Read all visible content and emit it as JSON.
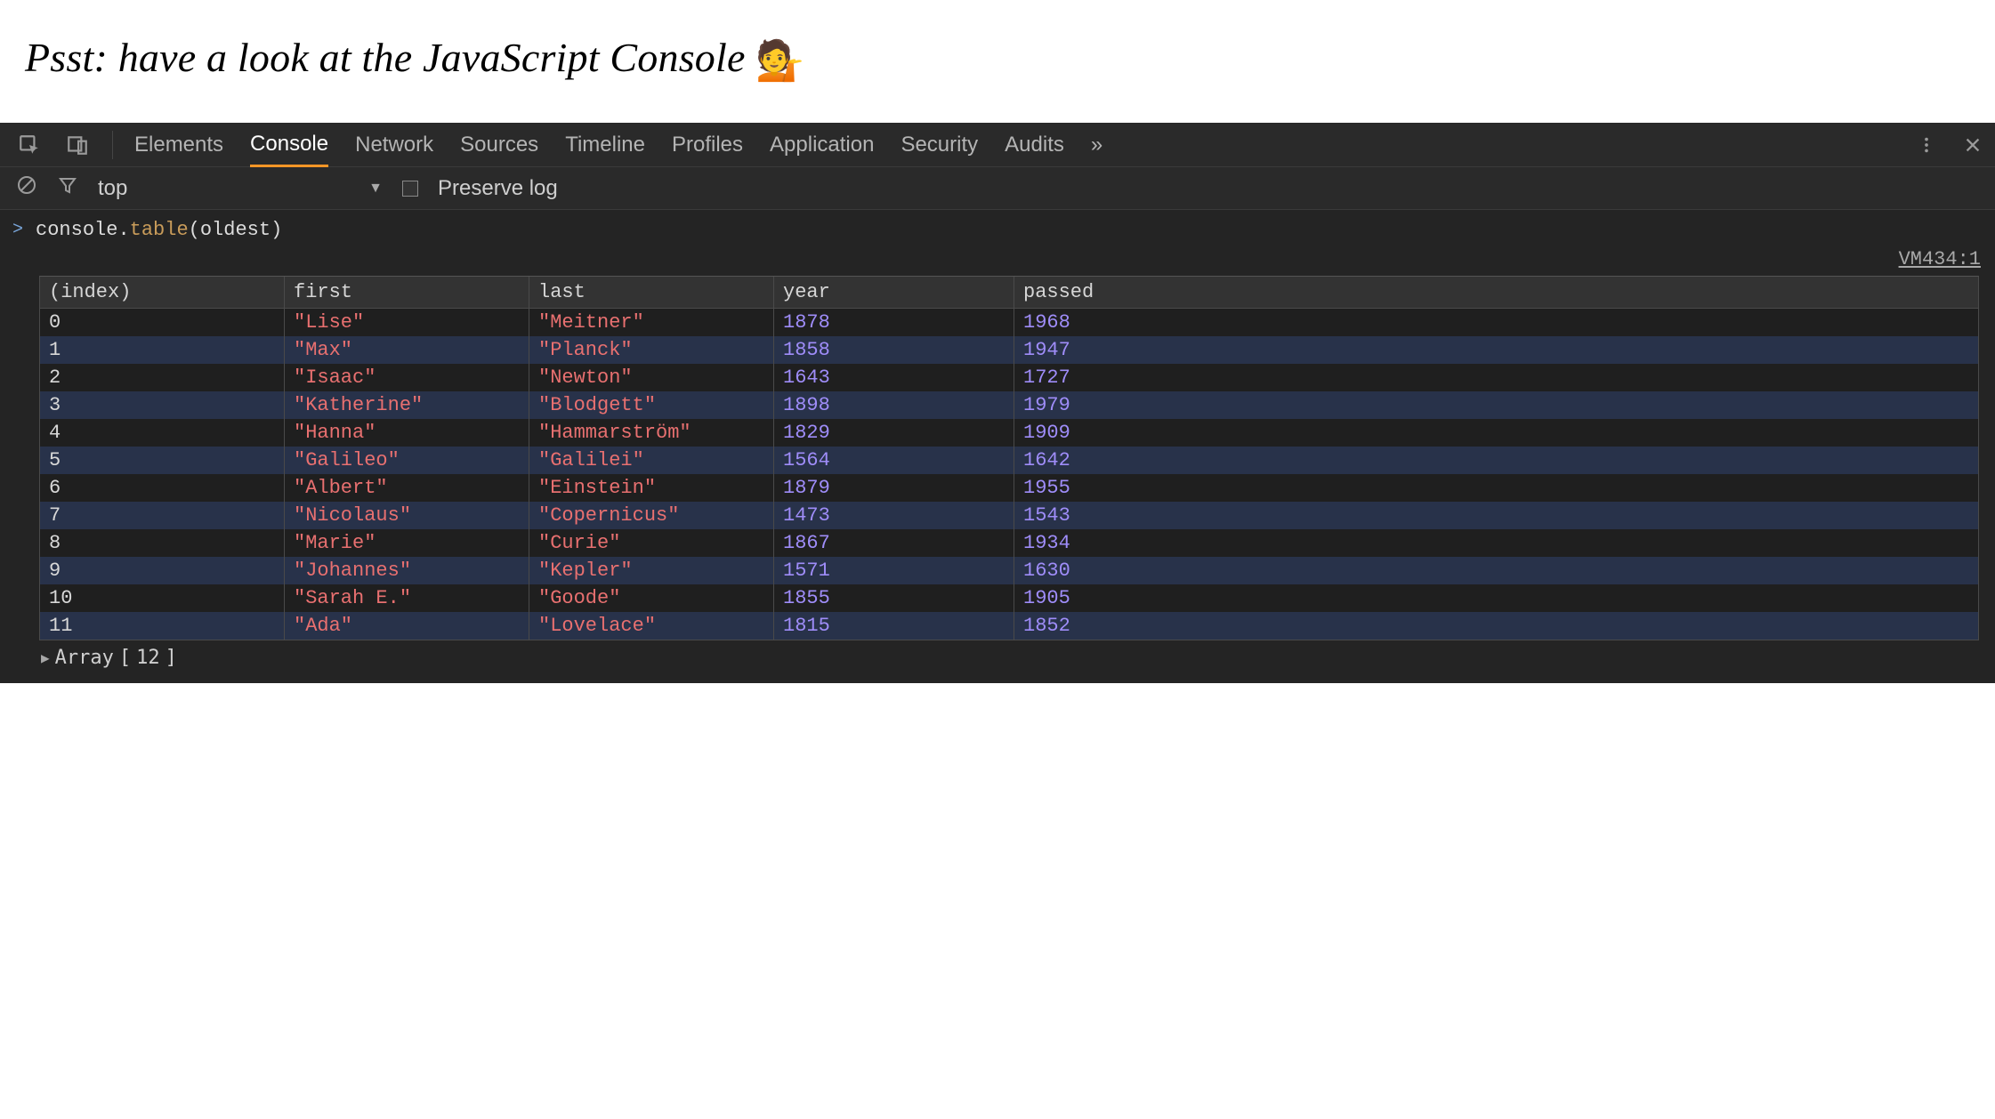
{
  "page": {
    "hint_text": "Psst: have a look at the JavaScript Console",
    "hint_emoji": "💁"
  },
  "devtools": {
    "tabs": [
      "Elements",
      "Console",
      "Network",
      "Sources",
      "Timeline",
      "Profiles",
      "Application",
      "Security",
      "Audits"
    ],
    "active_tab": "Console",
    "overflow_glyph": "»",
    "filter": {
      "context_label": "top",
      "preserve_log_label": "Preserve log"
    },
    "console": {
      "prompt_caret": ">",
      "command_obj": "console",
      "command_method": "table",
      "command_arg": "oldest",
      "source_ref": "VM434:1",
      "table": {
        "columns": [
          "(index)",
          "first",
          "last",
          "year",
          "passed"
        ],
        "rows": [
          {
            "index": 0,
            "first": "Lise",
            "last": "Meitner",
            "year": 1878,
            "passed": 1968
          },
          {
            "index": 1,
            "first": "Max",
            "last": "Planck",
            "year": 1858,
            "passed": 1947
          },
          {
            "index": 2,
            "first": "Isaac",
            "last": "Newton",
            "year": 1643,
            "passed": 1727
          },
          {
            "index": 3,
            "first": "Katherine",
            "last": "Blodgett",
            "year": 1898,
            "passed": 1979
          },
          {
            "index": 4,
            "first": "Hanna",
            "last": "Hammarström",
            "year": 1829,
            "passed": 1909
          },
          {
            "index": 5,
            "first": "Galileo",
            "last": "Galilei",
            "year": 1564,
            "passed": 1642
          },
          {
            "index": 6,
            "first": "Albert",
            "last": "Einstein",
            "year": 1879,
            "passed": 1955
          },
          {
            "index": 7,
            "first": "Nicolaus",
            "last": "Copernicus",
            "year": 1473,
            "passed": 1543
          },
          {
            "index": 8,
            "first": "Marie",
            "last": "Curie",
            "year": 1867,
            "passed": 1934
          },
          {
            "index": 9,
            "first": "Johannes",
            "last": "Kepler",
            "year": 1571,
            "passed": 1630
          },
          {
            "index": 10,
            "first": "Sarah E.",
            "last": "Goode",
            "year": 1855,
            "passed": 1905
          },
          {
            "index": 11,
            "first": "Ada",
            "last": "Lovelace",
            "year": 1815,
            "passed": 1852
          }
        ]
      },
      "array_summary_label": "Array",
      "array_summary_count": 12
    }
  }
}
